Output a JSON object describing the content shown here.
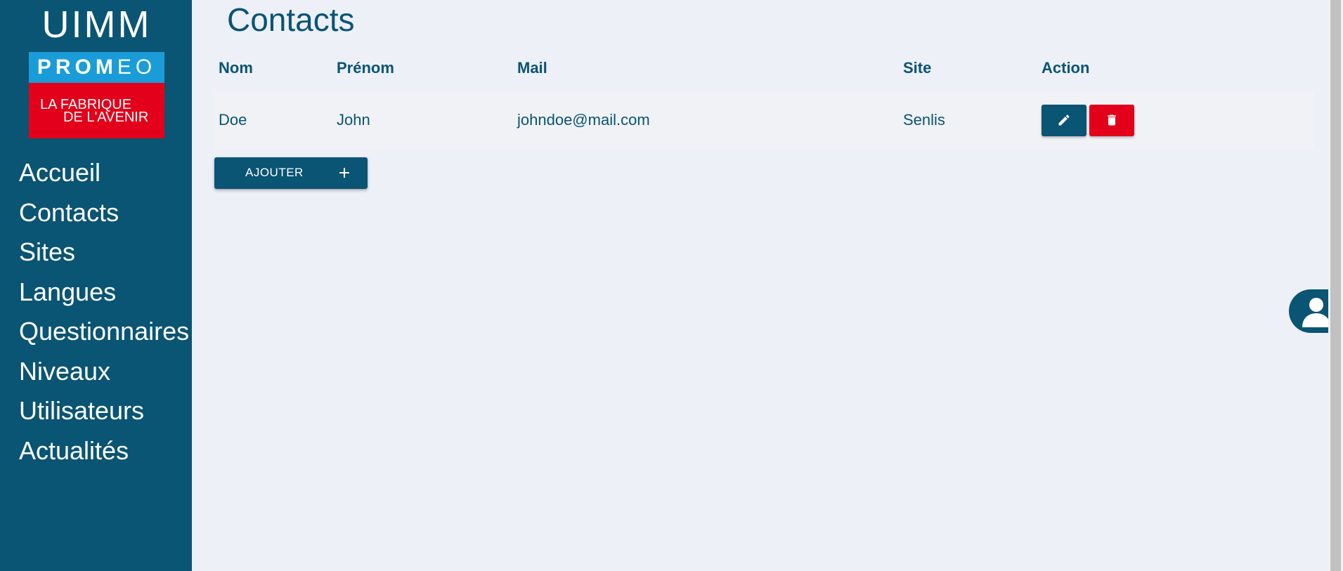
{
  "logo": {
    "uimm": "UIMM",
    "promeo_bold": "PROM",
    "promeo_thin": "EO",
    "tagline_1": "LA FABRIQUE",
    "tagline_2": "DE L'AVENIR"
  },
  "sidebar": {
    "items": [
      {
        "label": "Accueil"
      },
      {
        "label": "Contacts"
      },
      {
        "label": "Sites"
      },
      {
        "label": "Langues"
      },
      {
        "label": "Questionnaires"
      },
      {
        "label": "Niveaux"
      },
      {
        "label": "Utilisateurs"
      },
      {
        "label": "Actualités"
      }
    ]
  },
  "main": {
    "title": "Contacts",
    "table": {
      "headers": [
        "Nom",
        "Prénom",
        "Mail",
        "Site",
        "Action"
      ],
      "rows": [
        {
          "nom": "Doe",
          "prenom": "John",
          "mail": "johndoe@mail.com",
          "site": "Senlis"
        }
      ]
    },
    "add_button": {
      "label": "AJOUTER",
      "icon": "plus-icon"
    },
    "row_actions": {
      "edit_icon": "pencil-icon",
      "delete_icon": "trash-icon"
    }
  },
  "user_menu": {
    "icon": "user-icon"
  },
  "colors": {
    "primary": "#0a5474",
    "danger": "#e2001a",
    "promeo_blue": "#1a9cd8",
    "background": "#edf0f7"
  }
}
